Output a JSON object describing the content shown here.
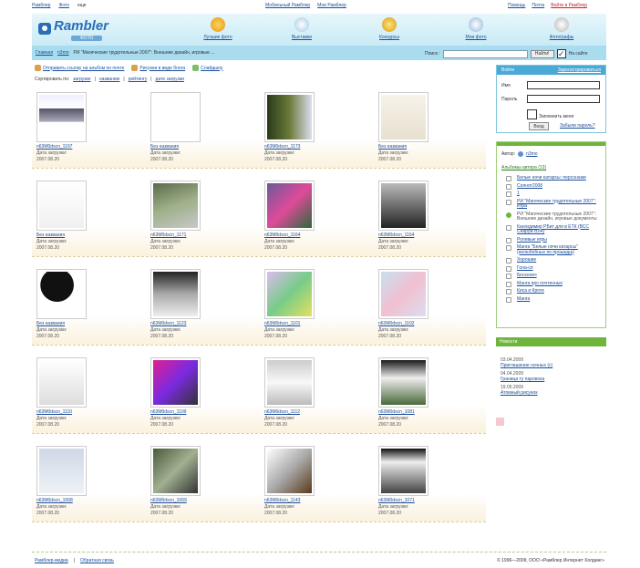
{
  "topbar": {
    "left": [
      "Рамблер",
      "Фото",
      "еще"
    ],
    "center": [
      "Мобильный Рамблер",
      "Мои Рамблер"
    ],
    "right": [
      "Помощь",
      "Почта",
      "Войти в Рамблер"
    ]
  },
  "header": {
    "logo_word": "Rambler",
    "logo_sub": "ФОТО",
    "nav": [
      "Лучшие фото",
      "Выставки",
      "Конкурсы",
      "Мои фото",
      "Фотографы"
    ]
  },
  "subbar": {
    "crumbs": [
      "Главная",
      "n3mo",
      "РИ \"Магические трудотельные 2007\": Внешние дизайн, игровые ..."
    ],
    "search_label": "Поиск :",
    "search_value": "",
    "find_button": "Найти!",
    "checkbox_label": "На сайте"
  },
  "actions": [
    "Отправить ссылку на альбом по почте",
    "Рисунки в виде блога",
    "Слайдшоу"
  ],
  "sort": {
    "label": "Сортировать по:",
    "options": [
      "загрузке",
      "названию",
      "рейтингу",
      "дате загрузки"
    ]
  },
  "gallery": {
    "date_label": "Дата загрузки:",
    "rows": [
      [
        {
          "title": "n63M0dscn_1197",
          "date": "2007.08.20"
        },
        {
          "title": "Без названия",
          "date": "2007.08.20"
        },
        {
          "title": "n63M0dscn_1173",
          "date": "2007.08.20"
        },
        {
          "title": "Без названия",
          "date": "2007.08.20"
        }
      ],
      [
        {
          "title": "Без названия",
          "date": "2007.08.20"
        },
        {
          "title": "n63M0dscn_1171",
          "date": "2007.08.20"
        },
        {
          "title": "n63M0dscn_1164",
          "date": "2007.08.20"
        },
        {
          "title": "n63M0dscn_1164",
          "date": "2007.08.20"
        }
      ],
      [
        {
          "title": "Без названия",
          "date": "2007.08.20"
        },
        {
          "title": "n63M0dscn_1123",
          "date": "2007.08.20"
        },
        {
          "title": "n63M0dscn_1101",
          "date": "2007.08.20"
        },
        {
          "title": "n63M0dscn_1102",
          "date": "2007.08.20"
        }
      ],
      [
        {
          "title": "n63M0dscn_1110",
          "date": "2007.08.20"
        },
        {
          "title": "n63M0dscn_1109",
          "date": "2007.08.20"
        },
        {
          "title": "n63M0dscn_1112",
          "date": "2007.08.20"
        },
        {
          "title": "n63M0dscn_1081",
          "date": "2007.08.20"
        }
      ],
      [
        {
          "title": "n63M0dscn_1068",
          "date": "2007.08.20"
        },
        {
          "title": "n63M0dscn_1069",
          "date": "2007.08.20"
        },
        {
          "title": "n63M0dscn_1143",
          "date": "2007.08.20"
        },
        {
          "title": "n63M0dscn_1071",
          "date": "2007.08.20"
        }
      ]
    ]
  },
  "login": {
    "tab": "Войти",
    "register": "Зарегистрироваться",
    "name_label": "Имя",
    "password_label": "Пароль",
    "remember_label": "Запомнить меня",
    "submit": "Вход",
    "forgot": "Забыли пароль?"
  },
  "author": {
    "label": "Автор:",
    "name": "n3mo",
    "albums_header": "Альбомы автора (13)",
    "albums": [
      {
        "label": "Белые ночи катарсы: персонажи",
        "current": false
      },
      {
        "label": "Солнот2008",
        "current": false
      },
      {
        "label": "1",
        "current": false
      },
      {
        "label": "РИ \"Магические трудотельные 2007\": Игра",
        "current": false
      },
      {
        "label": "РИ \"Магические трудотельные 2007\": Внешние дизайн, игровые документы",
        "current": true
      },
      {
        "label": "Кангидимир РБит для в ЕТК (ВСС Снаруж ВУА)",
        "current": false
      },
      {
        "label": "Ролевые игры",
        "current": false
      },
      {
        "label": "Манга \"Белые ночи катарсы\" (нелюбобных по прошедш)",
        "current": false
      },
      {
        "label": "Хорошие",
        "current": false
      },
      {
        "label": "Гола-ся",
        "current": false
      },
      {
        "label": "Бесконеч",
        "current": false
      },
      {
        "label": "Манга про почтенных",
        "current": false
      },
      {
        "label": "Киса и Кроте",
        "current": false
      },
      {
        "label": "Манга",
        "current": false
      }
    ]
  },
  "news": {
    "title": "Новости",
    "items": [
      {
        "date": "03.04.2009",
        "text": "Приглашение ночных (с)"
      },
      {
        "date": "04.04.2009",
        "text": "Граница ту паровоза"
      },
      {
        "date": "19.05.2009",
        "text": "Атомный рисунок"
      }
    ]
  },
  "footer": {
    "left": [
      "Рамблер-медиа",
      "Обратная связь"
    ],
    "right": "© 1996—2009, ООО «Рамблер Интернет Холдинг»"
  },
  "colors": {
    "header_bg": "#c9ebf6",
    "subbar_bg": "#a8dcee",
    "accent_green": "#6fb53c",
    "link": "#1a4e9c"
  }
}
